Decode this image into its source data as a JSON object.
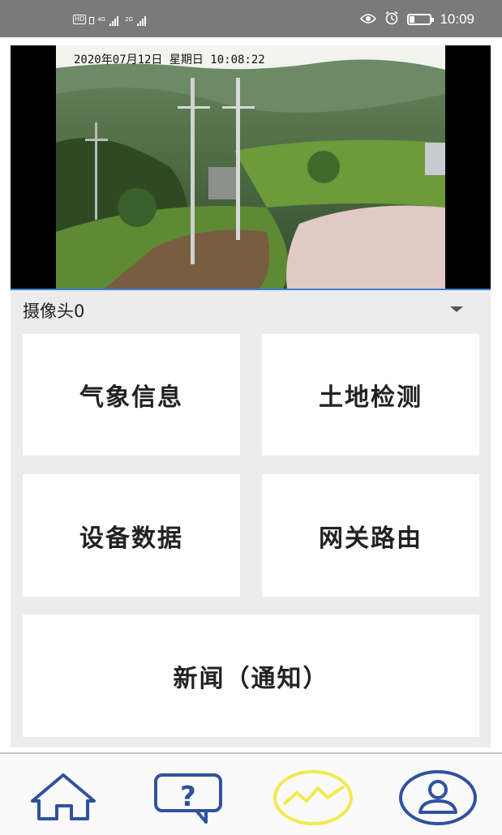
{
  "status_bar": {
    "hd_badge": "HD",
    "sim1_network": "4G",
    "sim2_network": "2G",
    "time": "10:09",
    "icons": [
      "eye-icon",
      "alarm-icon",
      "battery-icon"
    ]
  },
  "video": {
    "overlay_timestamp": "2020年07月12日 星期日 10:08:22"
  },
  "camera_select": {
    "selected": "摄像头0"
  },
  "tiles": {
    "weather": "气象信息",
    "land": "土地检测",
    "device": "设备数据",
    "gateway": "网关路由",
    "news": "新闻（通知）"
  },
  "bottom_nav": {
    "items": [
      "home-icon",
      "help-chat-icon",
      "chart-icon",
      "user-icon"
    ],
    "active": "chart-icon",
    "accent_color": "#f2e94e",
    "icon_color": "#2f52a0"
  }
}
